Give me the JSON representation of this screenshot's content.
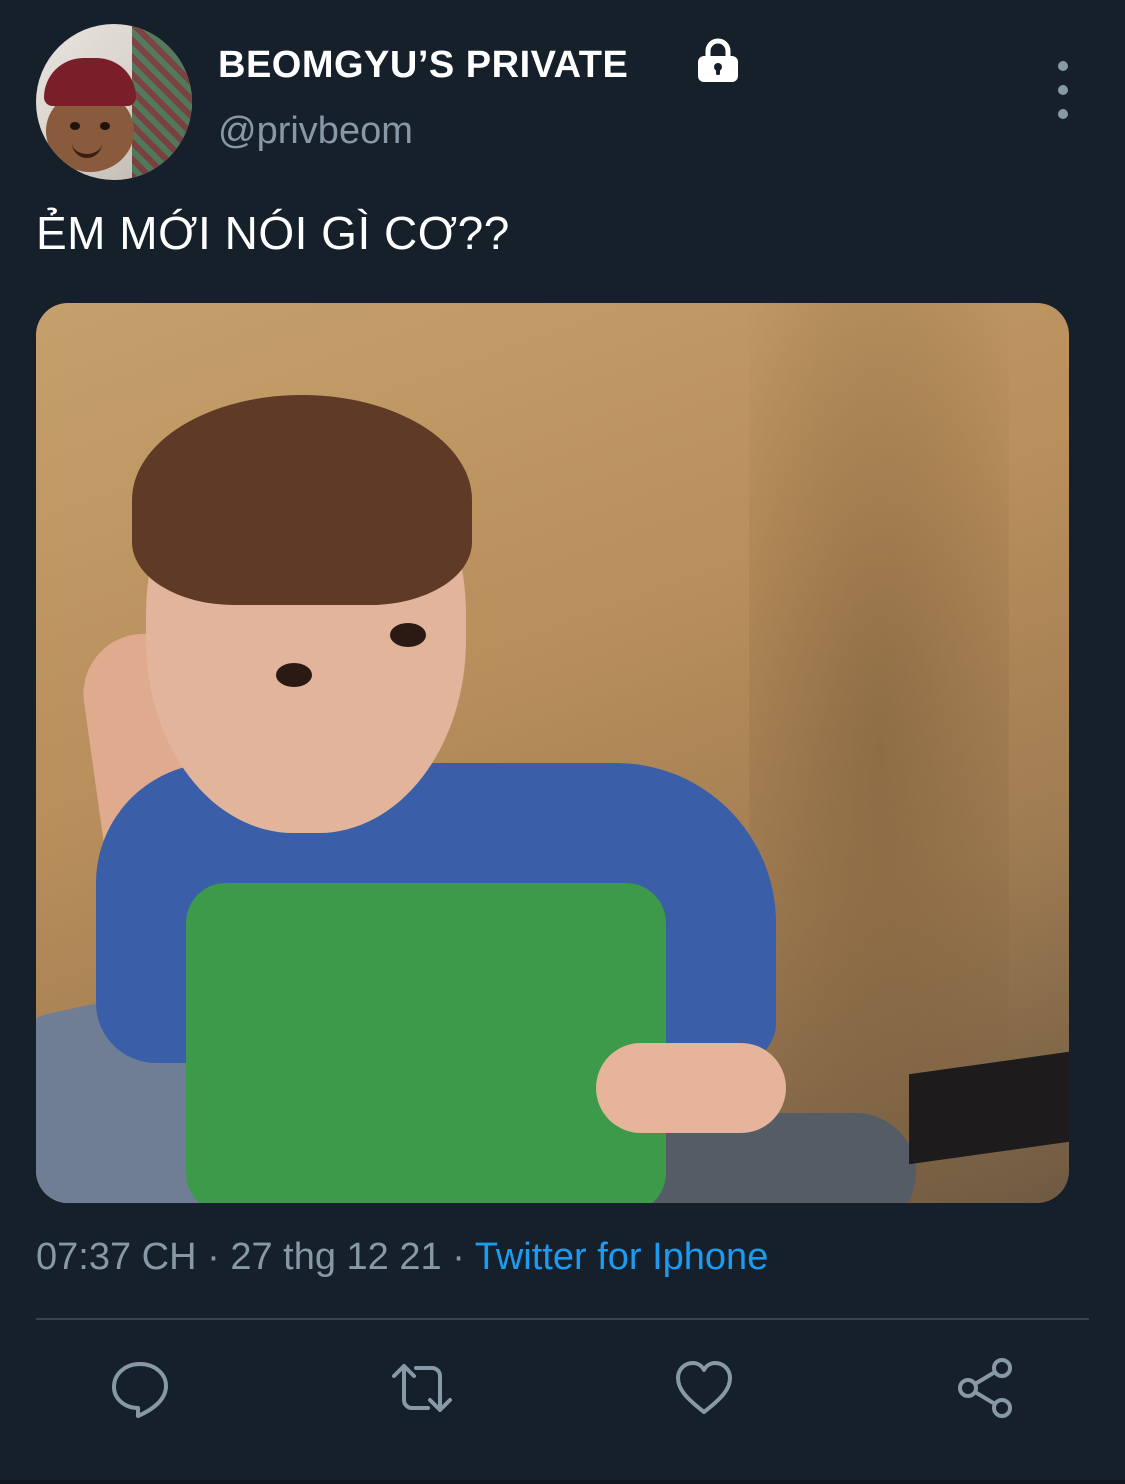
{
  "tweet": {
    "author": {
      "display_name": "BEOMGYU’S PRIVATE",
      "handle": "@privbeom",
      "protected_icon": "lock-icon"
    },
    "text": "ẺM MỚI NÓI GÌ CƠ??",
    "media": {
      "type": "photo",
      "subject": "child-in-blue-green-shirt"
    },
    "time": "07:37 CH",
    "separator": "·",
    "date": "27 thg 12 21",
    "source": "Twitter for Iphone"
  },
  "menu_icon": "more-vertical-icon",
  "actions": [
    {
      "name": "reply",
      "icon": "reply-icon"
    },
    {
      "name": "retweet",
      "icon": "retweet-icon"
    },
    {
      "name": "like",
      "icon": "heart-icon"
    },
    {
      "name": "share",
      "icon": "share-icon"
    }
  ],
  "colors": {
    "background": "#15202b",
    "text_primary": "#ffffff",
    "text_secondary": "#8899a6",
    "accent": "#1d9bf0",
    "divider": "#38444d"
  }
}
